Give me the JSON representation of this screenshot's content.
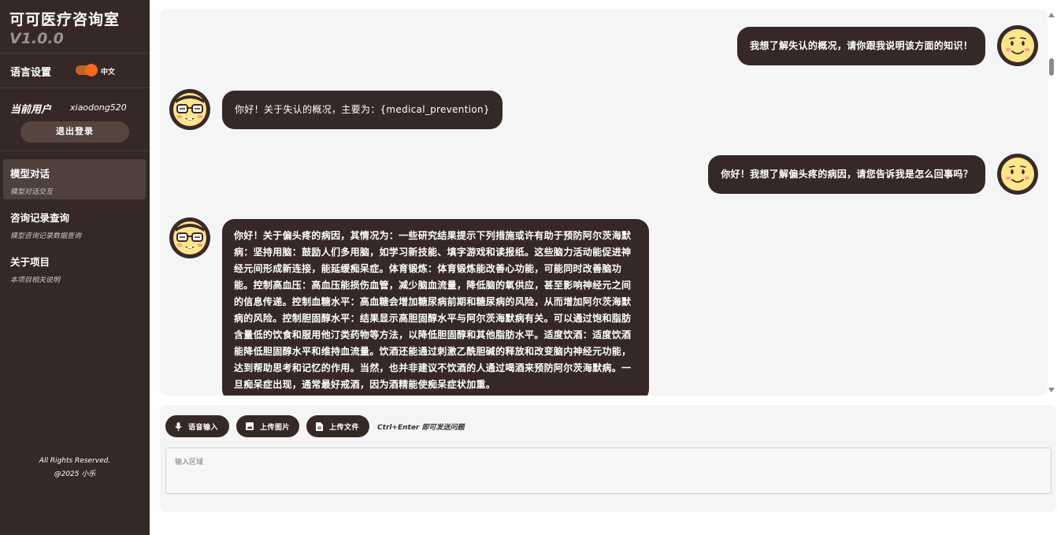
{
  "sidebar": {
    "title": "可可医疗咨询室",
    "version": "V1.0.0",
    "language_label": "语言设置",
    "language_value": "中文",
    "user_label": "当前用户",
    "user_name": "xiaodong520",
    "logout_label": "退出登录",
    "nav": [
      {
        "title": "模型对话",
        "sub": "模型对话交互"
      },
      {
        "title": "咨询记录查询",
        "sub": "模型咨询记录数据查询"
      },
      {
        "title": "关于项目",
        "sub": "本项目相关说明"
      }
    ],
    "footer_line1": "All Rights Reserved.",
    "footer_line2": "@2025 小乐"
  },
  "messages": [
    {
      "role": "user",
      "text": "我想了解失认的概况，请你跟我说明该方面的知识！"
    },
    {
      "role": "assistant",
      "text": "你好！关于失认的概况，主要为：{medical_prevention}"
    },
    {
      "role": "user",
      "text": "你好！我想了解偏头疼的病因，请您告诉我是怎么回事吗？"
    },
    {
      "role": "assistant",
      "text": "你好！关于偏头疼的病因，其情况为：一些研究结果提示下列措施或许有助于预防阿尔茨海默病：坚持用脑：鼓励人们多用脑，如学习新技能、填字游戏和读报纸。这些脑力活动能促进神经元间形成新连接，能延缓痴呆症。体育锻炼：体育锻炼能改善心功能，可能同时改善脑功能。控制高血压：高血压能损伤血管，减少脑血流量，降低脑的氧供应，甚至影响神经元之间的信息传递。控制血糖水平：高血糖会增加糖尿病前期和糖尿病的风险，从而增加阿尔茨海默病的风险。控制胆固醇水平：结果显示高胆固醇水平与阿尔茨海默病有关。可以通过饱和脂肪含量低的饮食和服用他汀类药物等方法，以降低胆固醇和其他脂肪水平。适度饮酒：适度饮酒能降低胆固醇水平和维持血流量。饮酒还能通过刺激乙酰胆碱的释放和改变脑内神经元功能，达到帮助思考和记忆的作用。当然，也并非建议不饮酒的人通过喝酒来预防阿尔茨海默病。一旦痴呆症出现，通常最好戒酒，因为酒精能使痴呆症状加重。"
    }
  ],
  "toolbar": {
    "voice_label": "语音输入",
    "image_label": "上传图片",
    "file_label": "上传文件",
    "hint": "Ctrl+Enter 即可发送问题"
  },
  "input": {
    "placeholder": "输入区域"
  },
  "icons": {
    "avatar_user": "smiley-face-icon",
    "avatar_assistant": "glasses-face-icon",
    "voice": "mic-icon",
    "image": "image-icon",
    "file": "file-icon"
  },
  "colors": {
    "sidebar_bg": "#362826",
    "bubble_bg": "#362826",
    "accent": "#f26a1f",
    "avatar_face": "#fde58a"
  }
}
